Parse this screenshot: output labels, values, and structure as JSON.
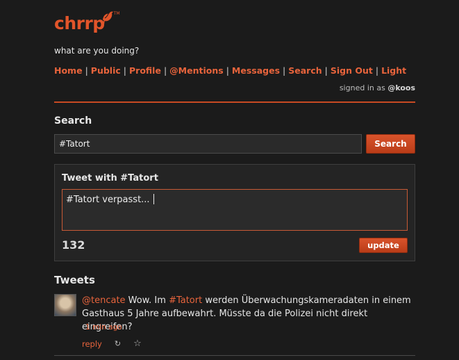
{
  "brand": {
    "name": "chrrp",
    "tm": "TM"
  },
  "tagline": "what are you doing?",
  "nav": {
    "items": [
      "Home",
      "Public",
      "Profile",
      "@Mentions",
      "Messages",
      "Search",
      "Sign Out",
      "Light"
    ],
    "separator": "|"
  },
  "signed_in": {
    "prefix": "signed in as",
    "user": "@koos"
  },
  "search": {
    "title": "Search",
    "value": "#Tatort",
    "button": "Search"
  },
  "compose": {
    "title": "Tweet with #Tatort",
    "text": "#Tatort verpasst...",
    "counter": "132",
    "button": "update"
  },
  "tweets": {
    "title": "Tweets",
    "items": [
      {
        "user": "@tencate",
        "text_before": " Wow. Im ",
        "hashtag": "#Tatort",
        "text_after": " werden Überwachungskameradaten in einem Gasthaus 5 Jahre aufbewahrt. Müsste da die Polizei nicht direkt eingreifen?",
        "time": "1 min ago",
        "reply": "reply",
        "retweet_icon": "retweet-icon",
        "favorite_icon": "star-icon"
      }
    ]
  },
  "colors": {
    "accent": "#e8643c",
    "background": "#1b1b1b",
    "button": "#c8451f"
  }
}
